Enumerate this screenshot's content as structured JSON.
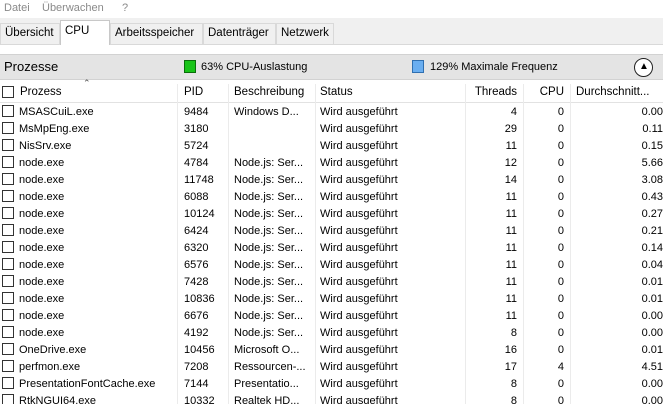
{
  "menu": [
    "Datei",
    "Überwachen",
    "?"
  ],
  "tabs": [
    "Übersicht",
    "CPU",
    "Arbeitsspeicher",
    "Datenträger",
    "Netzwerk"
  ],
  "active_tab": 1,
  "section": {
    "title": "Prozesse",
    "cpu_load": "63% CPU-Auslastung",
    "max_freq": "129% Maximale Frequenz",
    "colors": {
      "cpu_swatch": "#18c418",
      "freq_swatch": "#6aaef0"
    },
    "collapse_icon": "chevron-up-icon"
  },
  "columns": {
    "process": "Prozess",
    "pid": "PID",
    "description": "Beschreibung",
    "status": "Status",
    "threads": "Threads",
    "cpu": "CPU",
    "avg": "Durchschnitt..."
  },
  "rows": [
    {
      "name": "MSASCuiL.exe",
      "pid": "9484",
      "description": "Windows D...",
      "status": "Wird ausgeführt",
      "threads": "4",
      "cpu": "0",
      "avg": "0.00"
    },
    {
      "name": "MsMpEng.exe",
      "pid": "3180",
      "description": "",
      "status": "Wird ausgeführt",
      "threads": "29",
      "cpu": "0",
      "avg": "0.11"
    },
    {
      "name": "NisSrv.exe",
      "pid": "5724",
      "description": "",
      "status": "Wird ausgeführt",
      "threads": "11",
      "cpu": "0",
      "avg": "0.15"
    },
    {
      "name": "node.exe",
      "pid": "4784",
      "description": "Node.js: Ser...",
      "status": "Wird ausgeführt",
      "threads": "12",
      "cpu": "0",
      "avg": "5.66"
    },
    {
      "name": "node.exe",
      "pid": "11748",
      "description": "Node.js: Ser...",
      "status": "Wird ausgeführt",
      "threads": "14",
      "cpu": "0",
      "avg": "3.08"
    },
    {
      "name": "node.exe",
      "pid": "6088",
      "description": "Node.js: Ser...",
      "status": "Wird ausgeführt",
      "threads": "11",
      "cpu": "0",
      "avg": "0.43"
    },
    {
      "name": "node.exe",
      "pid": "10124",
      "description": "Node.js: Ser...",
      "status": "Wird ausgeführt",
      "threads": "11",
      "cpu": "0",
      "avg": "0.27"
    },
    {
      "name": "node.exe",
      "pid": "6424",
      "description": "Node.js: Ser...",
      "status": "Wird ausgeführt",
      "threads": "11",
      "cpu": "0",
      "avg": "0.21"
    },
    {
      "name": "node.exe",
      "pid": "6320",
      "description": "Node.js: Ser...",
      "status": "Wird ausgeführt",
      "threads": "11",
      "cpu": "0",
      "avg": "0.14"
    },
    {
      "name": "node.exe",
      "pid": "6576",
      "description": "Node.js: Ser...",
      "status": "Wird ausgeführt",
      "threads": "11",
      "cpu": "0",
      "avg": "0.04"
    },
    {
      "name": "node.exe",
      "pid": "7428",
      "description": "Node.js: Ser...",
      "status": "Wird ausgeführt",
      "threads": "11",
      "cpu": "0",
      "avg": "0.01"
    },
    {
      "name": "node.exe",
      "pid": "10836",
      "description": "Node.js: Ser...",
      "status": "Wird ausgeführt",
      "threads": "11",
      "cpu": "0",
      "avg": "0.01"
    },
    {
      "name": "node.exe",
      "pid": "6676",
      "description": "Node.js: Ser...",
      "status": "Wird ausgeführt",
      "threads": "11",
      "cpu": "0",
      "avg": "0.00"
    },
    {
      "name": "node.exe",
      "pid": "4192",
      "description": "Node.js: Ser...",
      "status": "Wird ausgeführt",
      "threads": "8",
      "cpu": "0",
      "avg": "0.00"
    },
    {
      "name": "OneDrive.exe",
      "pid": "10456",
      "description": "Microsoft O...",
      "status": "Wird ausgeführt",
      "threads": "16",
      "cpu": "0",
      "avg": "0.01"
    },
    {
      "name": "perfmon.exe",
      "pid": "7208",
      "description": "Ressourcen-...",
      "status": "Wird ausgeführt",
      "threads": "17",
      "cpu": "4",
      "avg": "4.51"
    },
    {
      "name": "PresentationFontCache.exe",
      "pid": "7144",
      "description": "Presentatio...",
      "status": "Wird ausgeführt",
      "threads": "8",
      "cpu": "0",
      "avg": "0.00"
    },
    {
      "name": "RtkNGUI64.exe",
      "pid": "10332",
      "description": "Realtek HD...",
      "status": "Wird ausgeführt",
      "threads": "8",
      "cpu": "0",
      "avg": "0.00"
    }
  ]
}
